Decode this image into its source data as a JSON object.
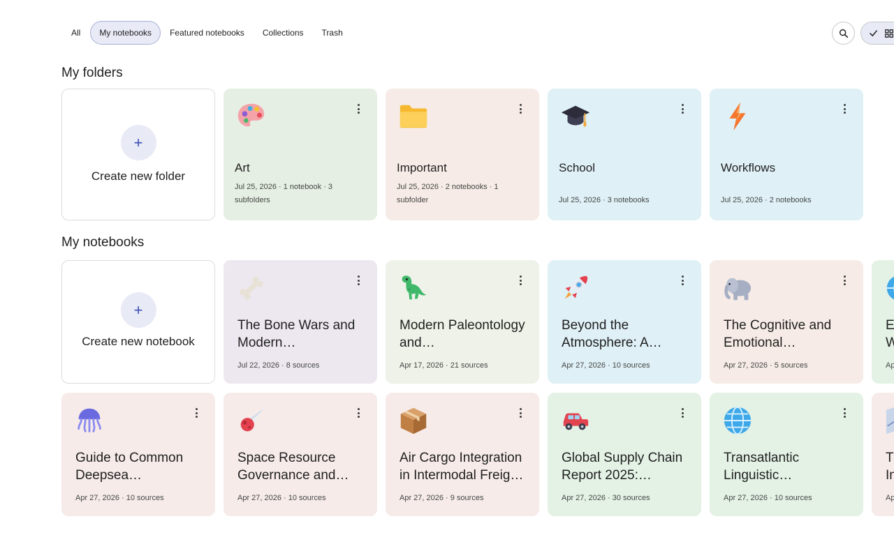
{
  "tabs": [
    {
      "label": "All",
      "active": false
    },
    {
      "label": "My notebooks",
      "active": true
    },
    {
      "label": "Featured notebooks",
      "active": false
    },
    {
      "label": "Collections",
      "active": false
    },
    {
      "label": "Trash",
      "active": false
    }
  ],
  "sections": {
    "folders_title": "My folders",
    "notebooks_title": "My notebooks"
  },
  "create_folder_label": "Create new folder",
  "create_notebook_label": "Create new notebook",
  "plus": "+",
  "folders": [
    {
      "title": "Art",
      "meta": "Jul 25, 2026 · 1 notebook · 3 subfolders",
      "icon": "palette-icon"
    },
    {
      "title": "Important",
      "meta": "Jul 25, 2026 · 2 notebooks · 1 subfolder",
      "icon": "folder-icon"
    },
    {
      "title": "School",
      "meta": "Jul 25, 2026 · 3 notebooks",
      "icon": "graduation-cap-icon"
    },
    {
      "title": "Workflows",
      "meta": "Jul 25, 2026 · 2 notebooks",
      "icon": "lightning-icon"
    }
  ],
  "notebooks": [
    {
      "title": "The Bone Wars and Modern…",
      "meta": "Jul 22, 2026 · 8 sources",
      "icon": "bone-icon"
    },
    {
      "title": "Modern Paleontology and…",
      "meta": "Apr 17, 2026 · 21 sources",
      "icon": "dinosaur-icon"
    },
    {
      "title": "Beyond the Atmosphere: A…",
      "meta": "Apr 27, 2026 · 10 sources",
      "icon": "rocket-icon"
    },
    {
      "title": "The Cognitive and Emotional…",
      "meta": "Apr 27, 2026 · 5 sources",
      "icon": "elephant-icon"
    },
    {
      "title": "Ev W",
      "meta": "Ap",
      "icon": "globe-icon"
    },
    {
      "title": "Guide to Common Deepsea…",
      "meta": "Apr 27, 2026 · 10 sources",
      "icon": "jellyfish-icon"
    },
    {
      "title": "Space Resource Governance and…",
      "meta": "Apr 27, 2026 · 10 sources",
      "icon": "comet-icon"
    },
    {
      "title": "Air Cargo Integration in Intermodal Freig…",
      "meta": "Apr 27, 2026 · 9 sources",
      "icon": "package-icon"
    },
    {
      "title": "Global Supply Chain Report 2025:…",
      "meta": "Apr 27, 2026 · 30 sources",
      "icon": "car-icon"
    },
    {
      "title": "Transatlantic Linguistic…",
      "meta": "Apr 27, 2026 · 10 sources",
      "icon": "globe-icon"
    },
    {
      "title": "Th In",
      "meta": "Ap",
      "icon": "map-icon"
    }
  ]
}
